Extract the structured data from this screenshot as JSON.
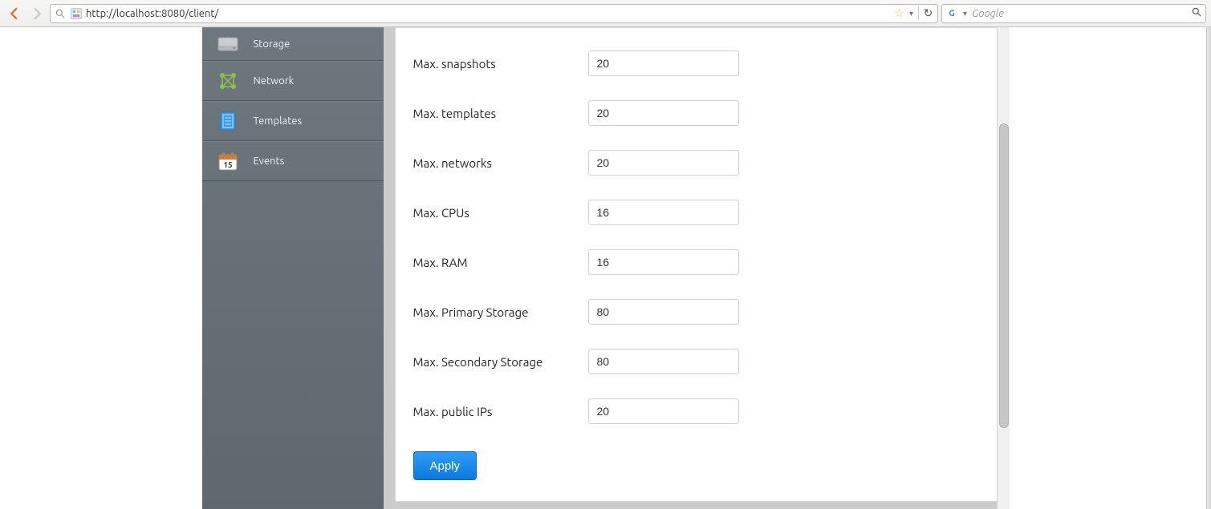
{
  "browser": {
    "url": "http://localhost:8080/client/",
    "search_placeholder": "Google"
  },
  "sidebar": {
    "items": [
      {
        "label": "Storage"
      },
      {
        "label": "Network"
      },
      {
        "label": "Templates"
      },
      {
        "label": "Events"
      }
    ]
  },
  "form": {
    "rows": [
      {
        "label": "Max. snapshots",
        "value": "20"
      },
      {
        "label": "Max. templates",
        "value": "20"
      },
      {
        "label": "Max. networks",
        "value": "20"
      },
      {
        "label": "Max. CPUs",
        "value": "16"
      },
      {
        "label": "Max. RAM",
        "value": "16"
      },
      {
        "label": "Max. Primary Storage",
        "value": "80"
      },
      {
        "label": "Max. Secondary Storage",
        "value": "80"
      },
      {
        "label": "Max. public IPs",
        "value": "20"
      }
    ],
    "apply_label": "Apply"
  },
  "icons": {
    "calendar_day": "15"
  }
}
